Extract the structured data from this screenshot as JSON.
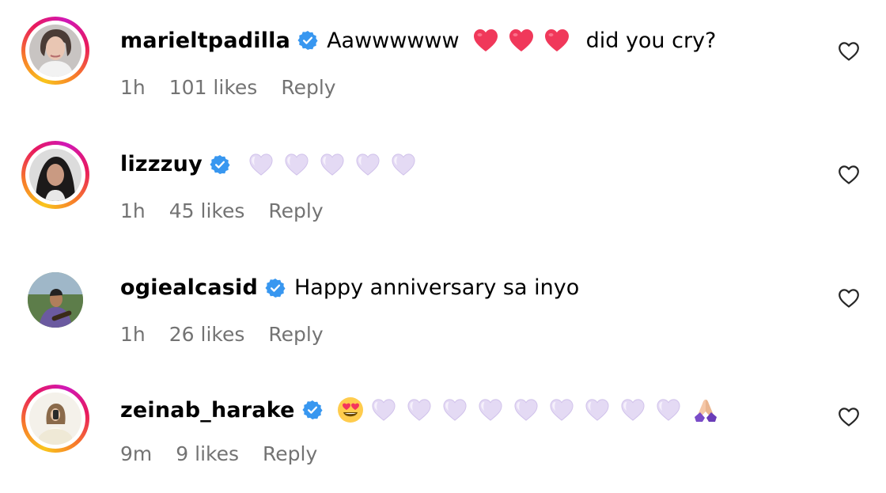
{
  "comments": [
    {
      "username": "marieltpadilla",
      "verified": true,
      "text": "Aawwwwww",
      "text_after": "did you cry?",
      "emojis": [
        "red-heart",
        "red-heart",
        "red-heart"
      ],
      "time": "1h",
      "likes": "101 likes",
      "reply": "Reply"
    },
    {
      "username": "lizzzuy",
      "verified": true,
      "text": "",
      "emojis": [
        "light-purple-heart",
        "light-purple-heart",
        "light-purple-heart",
        "light-purple-heart",
        "light-purple-heart"
      ],
      "time": "1h",
      "likes": "45 likes",
      "reply": "Reply"
    },
    {
      "username": "ogiealcasid",
      "verified": true,
      "text": "Happy anniversary sa inyo",
      "emojis": [],
      "time": "1h",
      "likes": "26 likes",
      "reply": "Reply"
    },
    {
      "username": "zeinab_harake",
      "verified": true,
      "text": "",
      "emojis": [
        "heart-eyes",
        "light-purple-heart x9",
        "folded-hands"
      ],
      "time": "9m",
      "likes": "9 likes",
      "reply": "Reply"
    }
  ],
  "colors": {
    "verified_blue": "#3897f0",
    "meta_gray": "#737373",
    "heart_red": "#f0385a",
    "heart_lavender": "#e6dcf5"
  }
}
